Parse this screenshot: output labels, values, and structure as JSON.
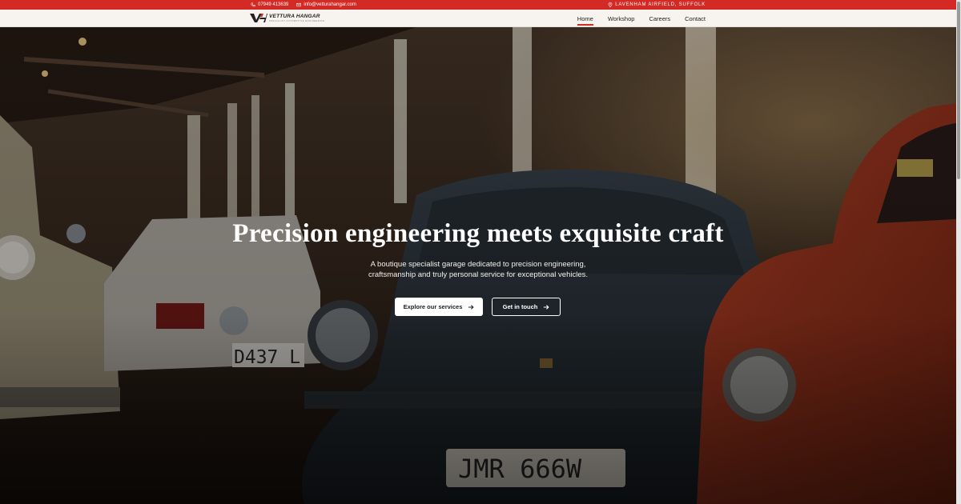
{
  "topbar": {
    "phone": "07949 413639",
    "email": "info@vetturahangar.com",
    "location": "LAVENHAM AIRFIELD, SUFFOLK"
  },
  "logo": {
    "name": "VETTURA HANGAR",
    "tagline": "SPECIALIST AUTOMOTIVE ENGINEERING"
  },
  "nav": {
    "items": [
      {
        "label": "Home",
        "active": true
      },
      {
        "label": "Workshop",
        "active": false
      },
      {
        "label": "Careers",
        "active": false
      },
      {
        "label": "Contact",
        "active": false
      }
    ]
  },
  "hero": {
    "title": "Precision engineering meets exquisite craft",
    "subtitle": "A boutique specialist garage dedicated to precision engineering, craftsmanship and truly personal service for exceptional vehicles.",
    "primary_button": "Explore our services",
    "secondary_button": "Get in touch",
    "plates": [
      "D437 L",
      "JMR 666W"
    ]
  },
  "colors": {
    "brand_red": "#d42a26",
    "nav_bg": "#f7f4ef"
  }
}
